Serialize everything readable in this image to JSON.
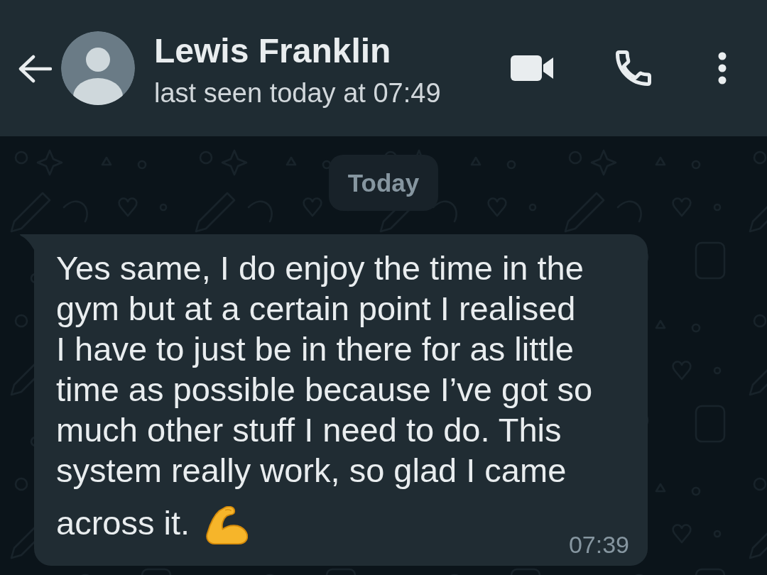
{
  "header": {
    "contact_name": "Lewis Franklin",
    "status": "last seen today at 07:49"
  },
  "chat": {
    "date_chip": "Today",
    "messages": [
      {
        "kind": "incoming",
        "lines": [
          "Yes same, I do enjoy the time in the",
          "gym but at a certain point I realised",
          "I have to just be in there for as little",
          "time as possible because I’ve got so",
          "much other stuff I need to do. This",
          "system really work, so glad I came",
          "across it."
        ],
        "time": "07:39"
      }
    ]
  }
}
